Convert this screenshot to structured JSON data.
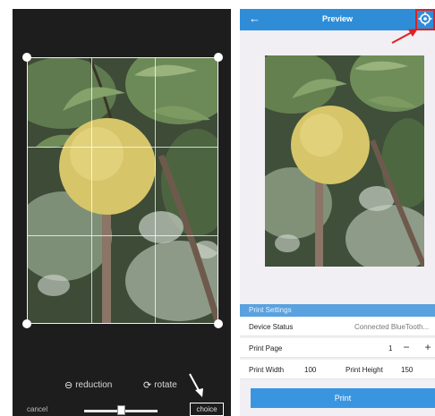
{
  "crop_screen": {
    "tools": {
      "reduction": "reduction",
      "rotate": "rotate"
    },
    "cancel": "cancel",
    "choice": "choice"
  },
  "preview_screen": {
    "header": {
      "title": "Preview",
      "back_icon": "back-arrow-icon",
      "settings_icon": "settings-gear-icon"
    },
    "settings": {
      "section_title": "Print Settings",
      "device_status_label": "Device Status",
      "device_status_value": "Connected BlueTooth...",
      "print_page_label": "Print Page",
      "print_page_value": "1",
      "print_width_label": "Print Width",
      "print_width_value": "100",
      "print_height_label": "Print Height",
      "print_height_value": "150",
      "minus": "−",
      "plus": "+"
    },
    "print_button": "Print"
  },
  "colors": {
    "header_blue": "#2f8dd8",
    "highlight_red": "#e02020",
    "dark_bg": "#1d1d1d"
  }
}
